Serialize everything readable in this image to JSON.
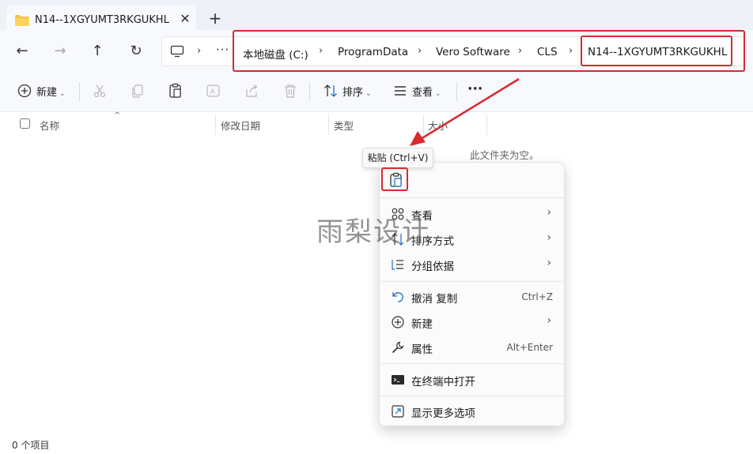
{
  "tab": {
    "title": "N14--1XGYUMT3RKGUKHL",
    "close": "✕",
    "new_tab": "+"
  },
  "nav": {
    "back": "←",
    "forward": "→",
    "up": "↑",
    "refresh": "↻",
    "more": "···"
  },
  "breadcrumbs": [
    "本地磁盘 (C:)",
    "ProgramData",
    "Vero Software",
    "CLS",
    "N14--1XGYUMT3RKGUKHL"
  ],
  "toolbar": {
    "new_label": "新建",
    "sort_label": "排序",
    "view_label": "查看",
    "more": "···",
    "icons": [
      "cut-icon",
      "copy-icon",
      "paste-icon",
      "rename-icon",
      "share-icon",
      "delete-icon"
    ]
  },
  "columns": [
    "名称",
    "修改日期",
    "类型",
    "大小"
  ],
  "empty_message": "此文件夹为空。",
  "tooltip": "粘贴 (Ctrl+V)",
  "context_menu": {
    "items": [
      {
        "label": "查看",
        "shortcut": "",
        "submenu": true,
        "icon": "view-grid-icon"
      },
      {
        "label": "排序方式",
        "shortcut": "",
        "submenu": true,
        "icon": "sort-icon"
      },
      {
        "label": "分组依据",
        "shortcut": "",
        "submenu": true,
        "icon": "group-icon"
      },
      {
        "label": "撤消 复制",
        "shortcut": "Ctrl+Z",
        "submenu": false,
        "icon": "undo-icon"
      },
      {
        "label": "新建",
        "shortcut": "",
        "submenu": true,
        "icon": "new-icon"
      },
      {
        "label": "属性",
        "shortcut": "Alt+Enter",
        "submenu": false,
        "icon": "properties-icon"
      },
      {
        "label": "在终端中打开",
        "shortcut": "",
        "submenu": false,
        "icon": "terminal-icon"
      },
      {
        "label": "显示更多选项",
        "shortcut": "",
        "submenu": false,
        "icon": "more-options-icon"
      }
    ]
  },
  "watermark": "雨梨设计",
  "status": "0 个项目",
  "colors": {
    "highlight": "#d62a2f",
    "accent": "#0067c0",
    "folder": "#f8c23f"
  }
}
